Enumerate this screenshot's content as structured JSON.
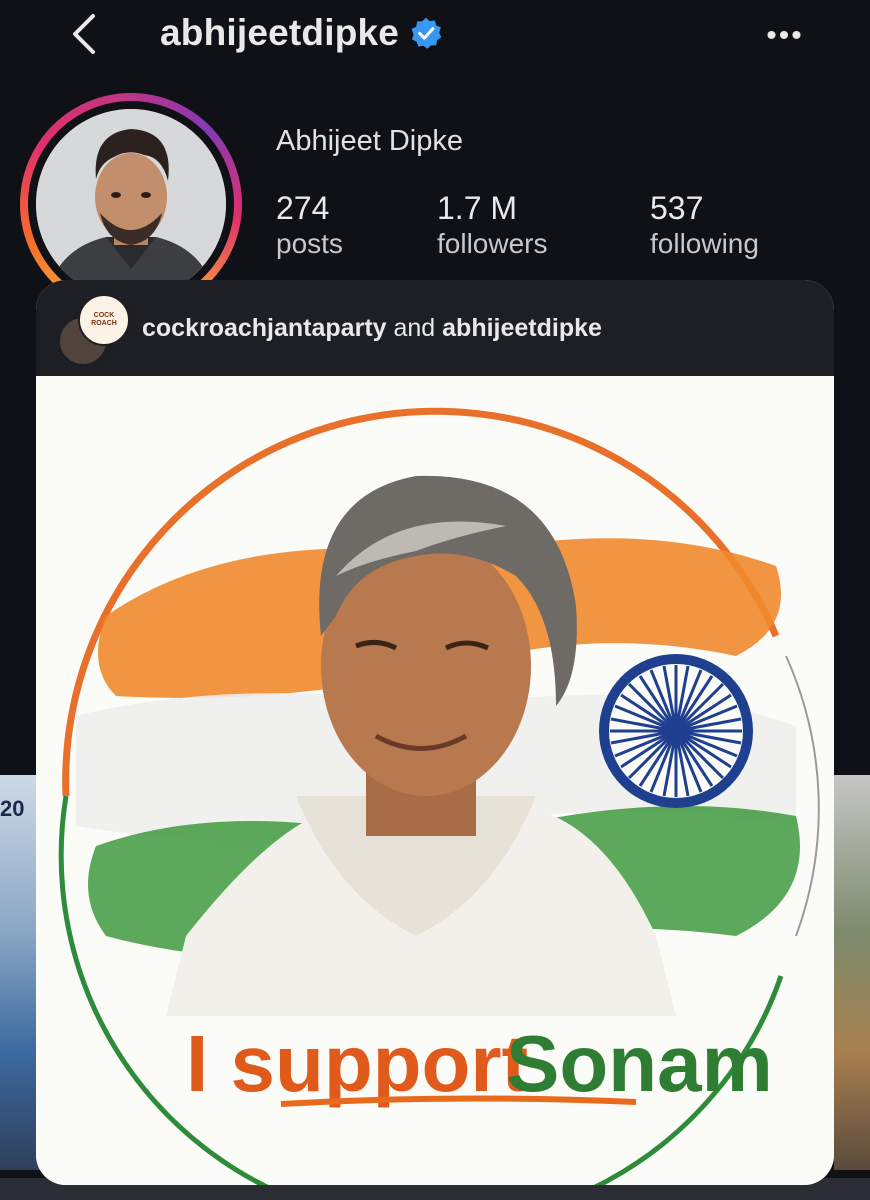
{
  "header": {
    "username": "abhijeetdipke",
    "back_icon": "chevron-left-icon",
    "verified_icon": "verified-badge-icon",
    "more_icon": "more-horizontal-icon",
    "more_label": "•••"
  },
  "profile": {
    "full_name": "Abhijeet Dipke",
    "stats": [
      {
        "value": "274",
        "label": "posts"
      },
      {
        "value": "1.7 M",
        "label": "followers"
      },
      {
        "value": "537",
        "label": "following"
      }
    ]
  },
  "background_posts": {
    "left_fragment_text": "20"
  },
  "post": {
    "collab_owner": "cockroachjantaparty",
    "collab_joiner": " and ",
    "collab_partner": "abhijeetdipke",
    "collab_logo_text": "COCKROACH JANTA PARTY",
    "image_caption_part1": "I support ",
    "image_caption_part2": "Sonam"
  },
  "colors": {
    "background": "#0f1116",
    "verified": "#3897f0",
    "saffron": "#e86a1c",
    "green": "#2e7d32",
    "chakra_blue": "#1f3f8f"
  }
}
